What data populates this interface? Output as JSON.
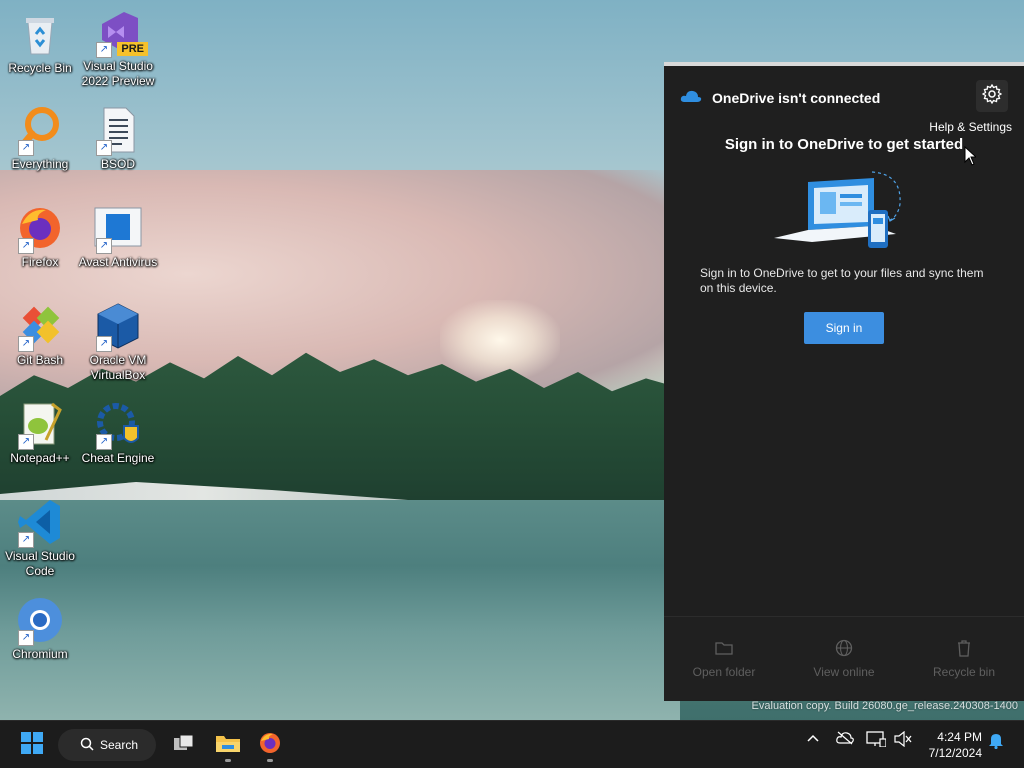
{
  "desktop": {
    "icons": [
      {
        "label": "Recycle Bin",
        "icon": "recycle-bin-icon"
      },
      {
        "label": "Visual Studio 2022 Preview",
        "icon": "visual-studio-preview-icon",
        "badge": "PRE"
      },
      {
        "label": "Everything",
        "icon": "everything-search-icon"
      },
      {
        "label": "BSOD",
        "icon": "document-icon"
      },
      {
        "label": "Firefox",
        "icon": "firefox-icon"
      },
      {
        "label": "Avast Antivirus",
        "icon": "avast-icon"
      },
      {
        "label": "Git Bash",
        "icon": "git-bash-icon"
      },
      {
        "label": "Oracle VM VirtualBox",
        "icon": "virtualbox-icon"
      },
      {
        "label": "Notepad++",
        "icon": "notepadpp-icon"
      },
      {
        "label": "Cheat Engine",
        "icon": "cheat-engine-icon"
      },
      {
        "label": "Visual Studio Code",
        "icon": "vscode-icon"
      },
      {
        "label": "Chromium",
        "icon": "chromium-icon"
      }
    ]
  },
  "onedrive": {
    "title": "OneDrive isn't connected",
    "settings_tooltip": "Help & Settings",
    "heading": "Sign in to OneDrive to get started",
    "description": "Sign in to OneDrive to get to your files and sync them on this device.",
    "signin_label": "Sign in",
    "footer": [
      {
        "label": "Open folder",
        "icon": "folder-icon"
      },
      {
        "label": "View online",
        "icon": "globe-icon"
      },
      {
        "label": "Recycle bin",
        "icon": "trash-icon"
      }
    ]
  },
  "watermark": "Evaluation copy. Build 26080.ge_release.240308-1400",
  "taskbar": {
    "search_label": "Search",
    "time": "4:24 PM",
    "date": "7/12/2024"
  },
  "colors": {
    "flyout_bg": "#1f1f1f",
    "accent": "#3c8ee0",
    "taskbar_bg": "#1c1c1c"
  }
}
